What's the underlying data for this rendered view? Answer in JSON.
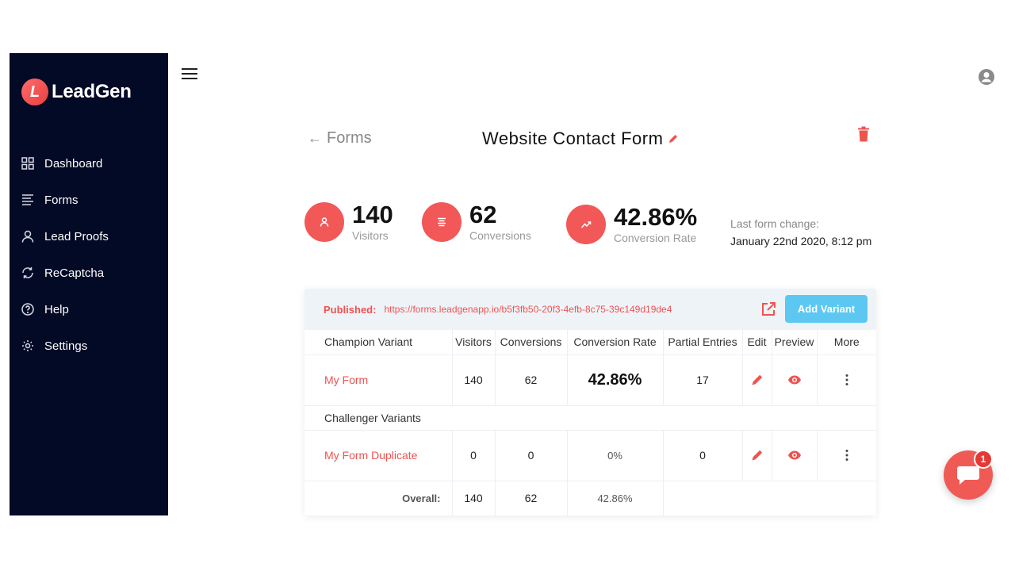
{
  "app": {
    "logo_letter": "L",
    "logo_text": "LeadGen",
    "brand_color": "#f25858",
    "sidebar_bg": "#030a26"
  },
  "sidebar": {
    "items": [
      {
        "label": "Dashboard",
        "icon": "grid-icon"
      },
      {
        "label": "Forms",
        "icon": "list-icon"
      },
      {
        "label": "Lead Proofs",
        "icon": "user-icon"
      },
      {
        "label": "ReCaptcha",
        "icon": "refresh-icon"
      },
      {
        "label": "Help",
        "icon": "help-icon"
      },
      {
        "label": "Settings",
        "icon": "gear-icon"
      }
    ]
  },
  "header": {
    "back_label": "Forms",
    "back_arrow": "←",
    "title": "Website Contact Form"
  },
  "stats": {
    "visitors": {
      "value": "140",
      "label": "Visitors"
    },
    "conversions": {
      "value": "62",
      "label": "Conversions"
    },
    "rate": {
      "value": "42.86%",
      "label": "Conversion Rate"
    },
    "last_change_label": "Last form change:",
    "last_change_value": "January 22nd 2020, 8:12 pm"
  },
  "published": {
    "label": "Published:",
    "url": "https://forms.leadgenapp.io/b5f3fb50-20f3-4efb-8c75-39c149d19de4",
    "add_variant_label": "Add Variant"
  },
  "table": {
    "columns": [
      "Champion Variant",
      "Visitors",
      "Conversions",
      "Conversion Rate",
      "Partial Entries",
      "Edit",
      "Preview",
      "More"
    ],
    "champion": {
      "name": "My Form",
      "visitors": "140",
      "conversions": "62",
      "rate": "42.86%",
      "partial": "17"
    },
    "challenger_heading": "Challenger Variants",
    "challenger": {
      "name": "My Form Duplicate",
      "visitors": "0",
      "conversions": "0",
      "rate": "0%",
      "partial": "0"
    },
    "overall": {
      "label": "Overall:",
      "visitors": "140",
      "conversions": "62",
      "rate": "42.86%"
    }
  },
  "chat": {
    "badge": "1"
  }
}
